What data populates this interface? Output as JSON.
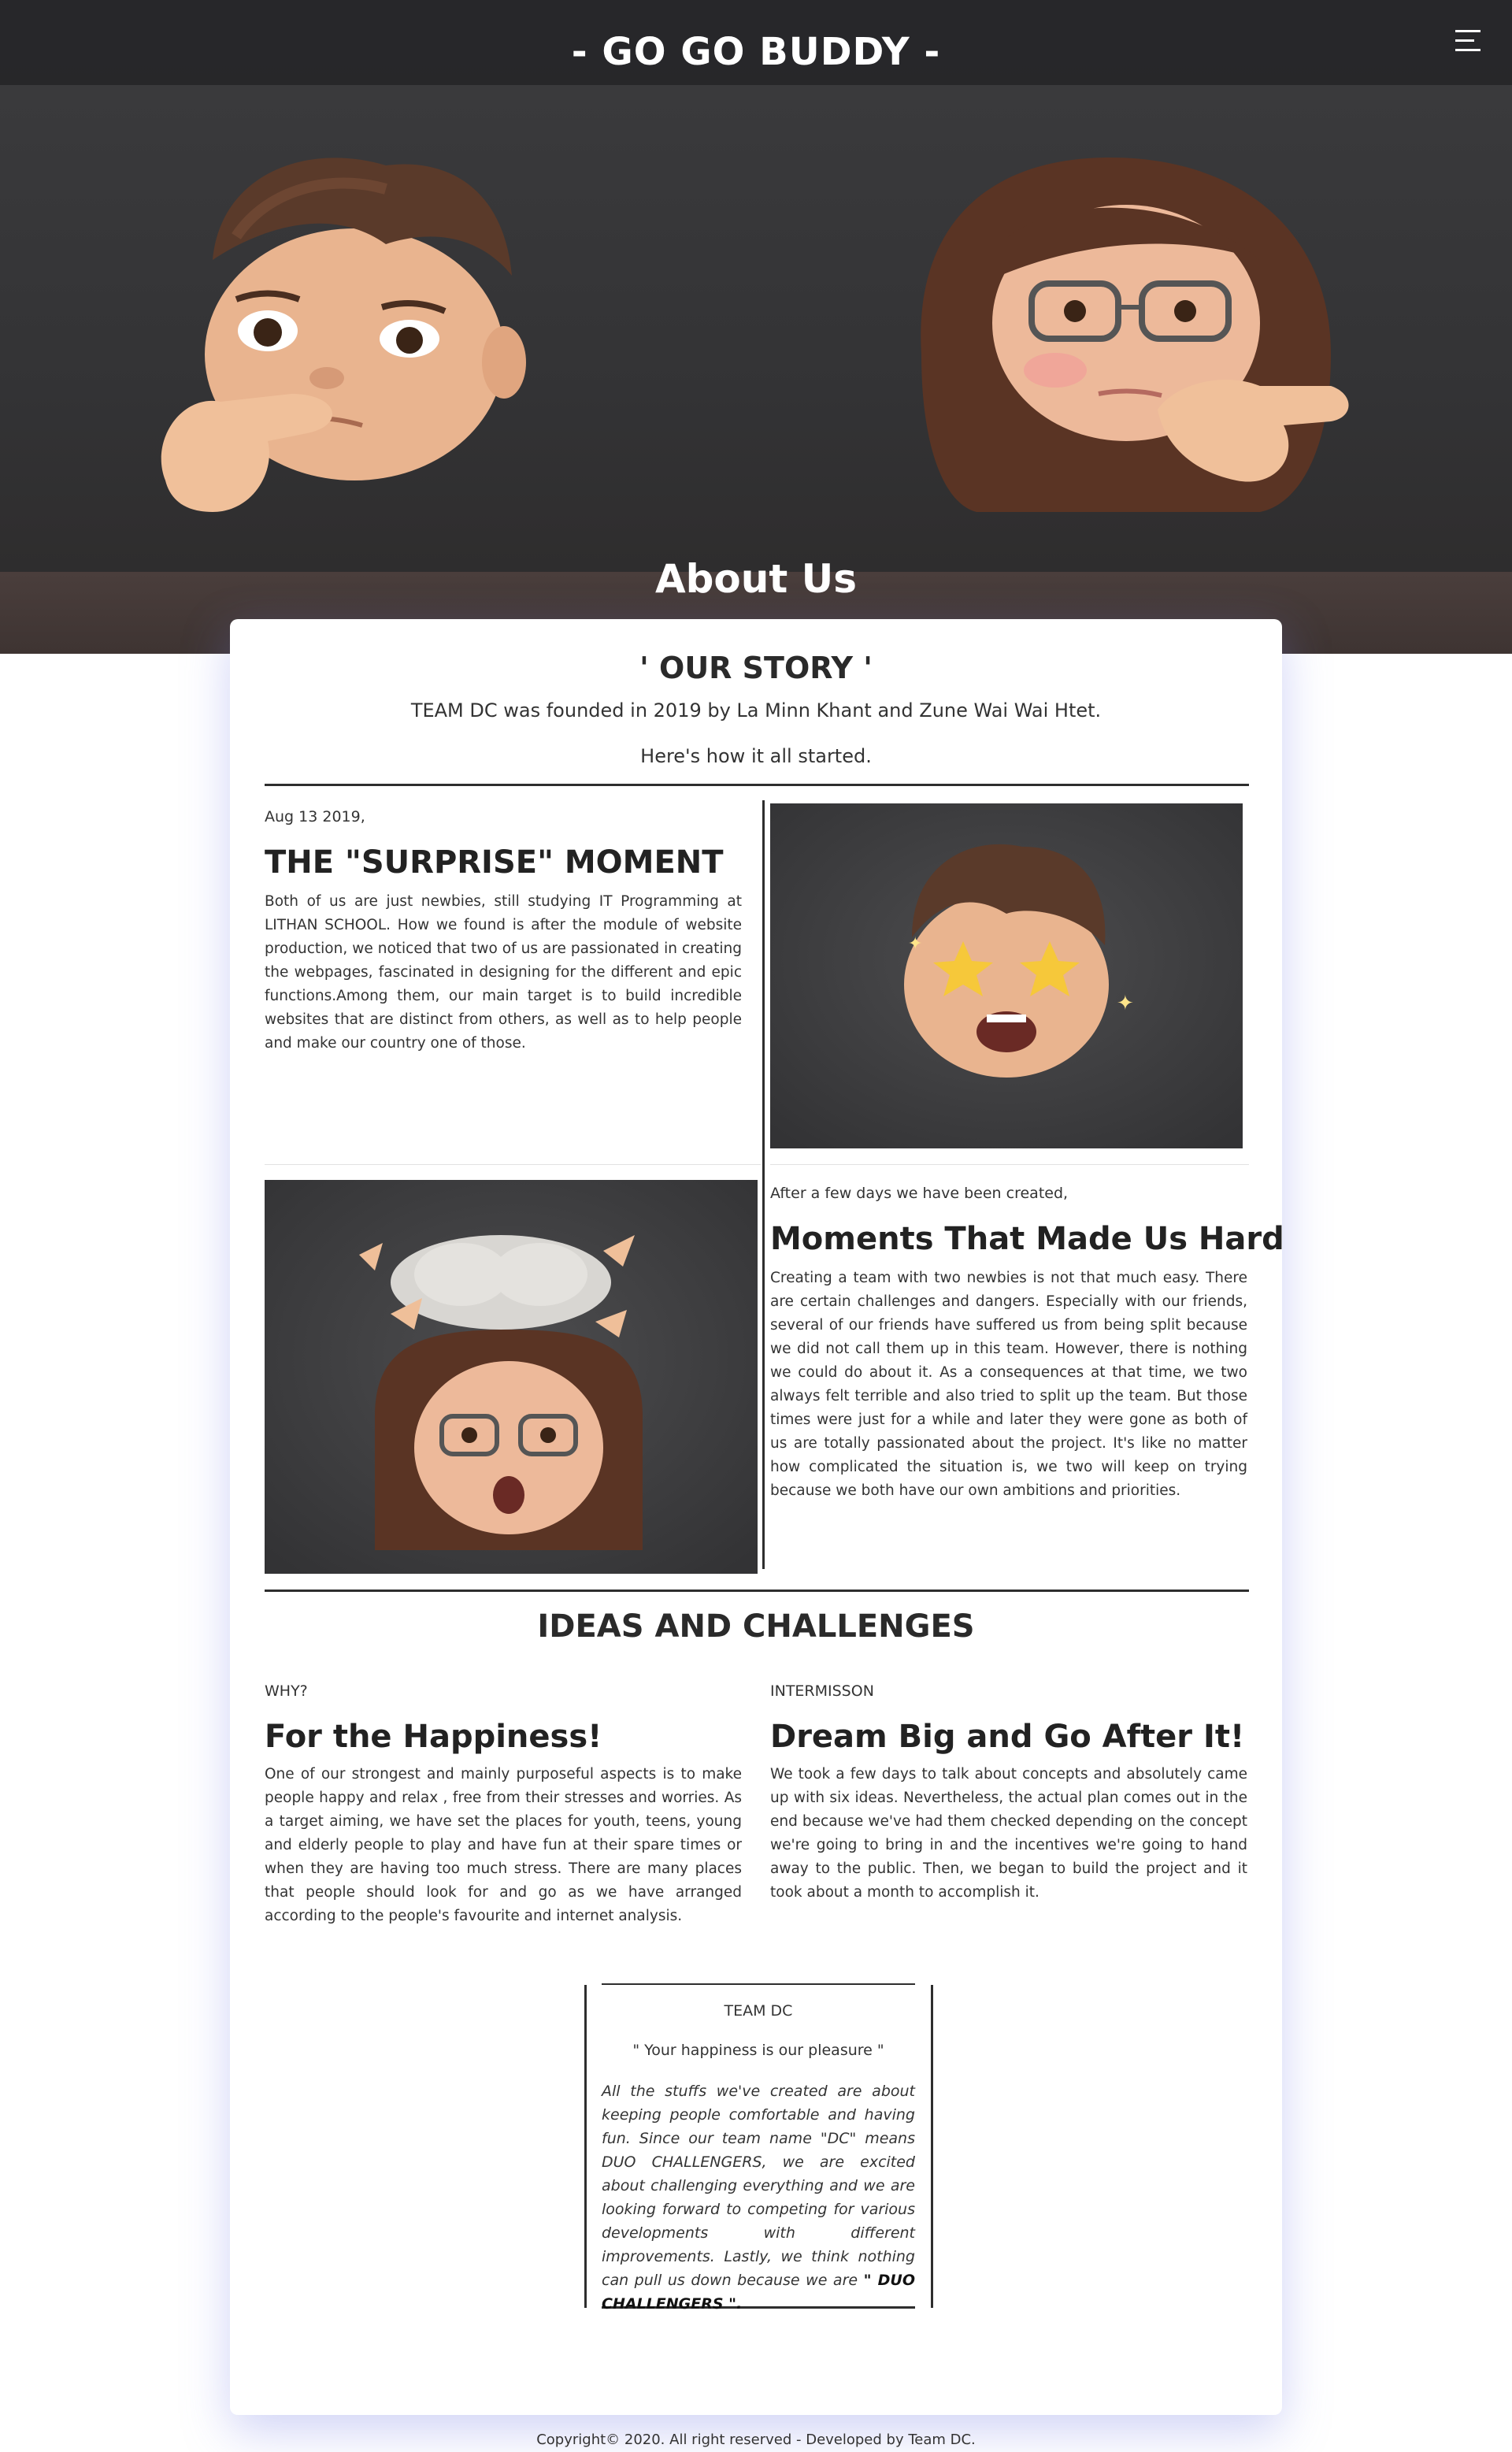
{
  "header": {
    "site_title": "- GO GO BUDDY -",
    "menu_icon": "hamburger-menu-icon"
  },
  "hero": {
    "section_title": "About Us"
  },
  "story": {
    "title": "' OUR STORY '",
    "intro_line_1": "TEAM DC was founded in 2019 by La Minn Khant and Zune Wai Wai Htet.",
    "intro_line_2": "Here's how it all started."
  },
  "moment_1": {
    "date": "Aug 13 2019,",
    "heading": "THE \"SURPRISE\" MOMENT",
    "body": "Both of us are just newbies, still studying IT Programming at LITHAN SCHOOL. How we found is after the module of website production, we noticed that two of us are passionated in creating the webpages, fascinated in designing for the different and epic functions.Among them, our main target is to build incredible websites that are distinct from others, as well as to help people and make our country one of those."
  },
  "moment_2": {
    "date": "After a few days we have been created,",
    "heading": "Moments That Made Us Hard",
    "body": "Creating a team with two newbies is not that much easy. There are certain challenges and dangers. Especially with our friends, several of our friends have suffered us from being split because we did not call them up in this team. However, there is nothing we could do about it. As a consequences at that time, we two always felt terrible and also tried to split up the team. But those times were just for a while and later they were gone as both of us are totally passionated about the project. It's like no matter how complicated the situation is, we two will keep on trying because we both have our own ambitions and priorities."
  },
  "ideas": {
    "section_title": "IDEAS AND CHALLENGES",
    "left": {
      "label": "WHY?",
      "heading": "For the Happiness!",
      "body": "One of our strongest and mainly purposeful aspects is to make people happy and relax , free from their stresses and worries. As a target aiming, we have set the places for youth, teens, young and elderly people to play and have fun at their spare times or when they are having too much stress. There are many places that people should look for and go as we have arranged according to the people's favourite and internet analysis."
    },
    "right": {
      "label": "INTERMISSON",
      "heading": "Dream Big and Go After It!",
      "body": "We took a few days to talk about concepts and absolutely came up with six ideas. Nevertheless, the actual plan comes out in the end because we've had them checked depending on the concept we're going to bring in and the incentives we're going to hand away to the public. Then, we began to build the project and it took about a month to accomplish it."
    }
  },
  "quote": {
    "team": "TEAM DC",
    "motto": "\" Your happiness is our pleasure \"",
    "body": "All the stuffs we've created are about keeping people comfortable and having fun. Since our team name \"DC\" means DUO CHALLENGERS, we are excited about challenging everything and we are looking forward to competing for various developments with different improvements. Lastly, we think nothing can pull us down because we are",
    "emphasis": "\" DUO CHALLENGERS \".",
    "ending": ""
  },
  "footer": {
    "copyright": "Copyright© 2020. All right reserved - Developed by Team DC."
  }
}
